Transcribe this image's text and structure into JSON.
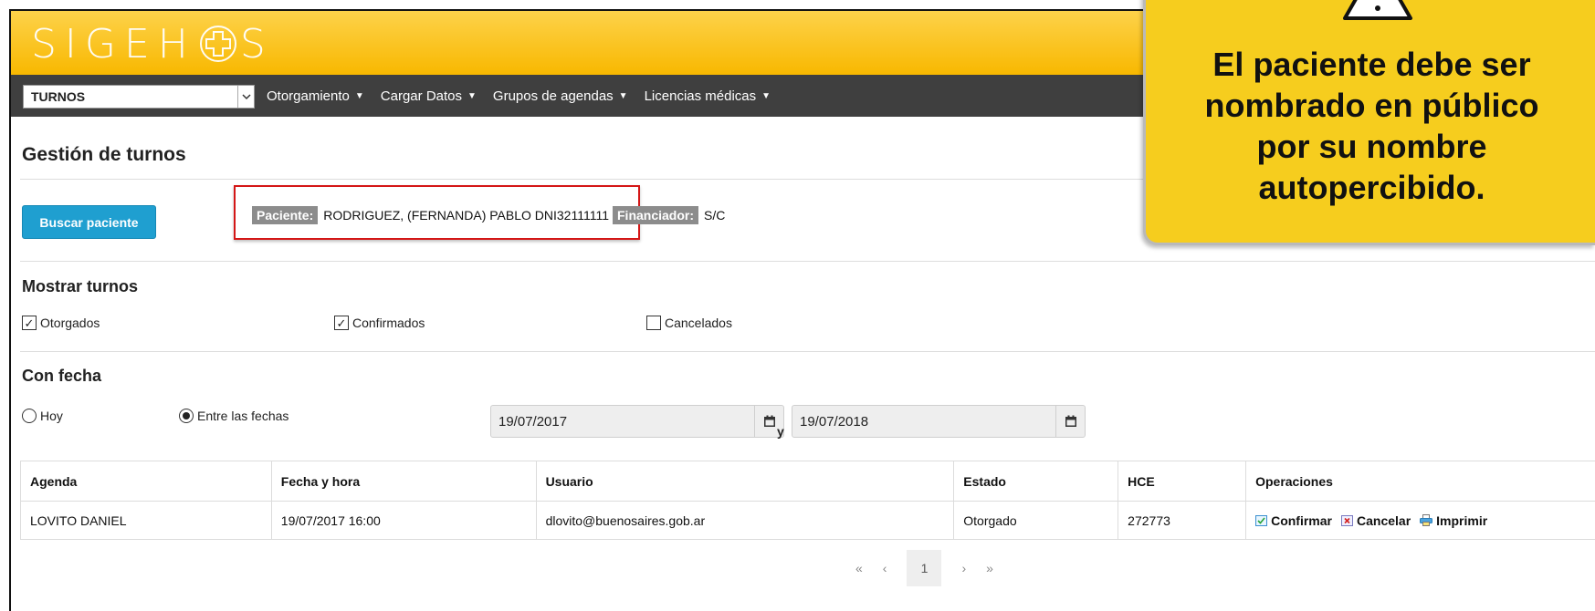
{
  "app": {
    "logo_left": "SIGEH",
    "logo_right": "S"
  },
  "nav": {
    "module": "TURNOS",
    "menu": [
      {
        "label": "Otorgamiento"
      },
      {
        "label": "Cargar Datos"
      },
      {
        "label": "Grupos de agendas"
      },
      {
        "label": "Licencias médicas"
      }
    ]
  },
  "page": {
    "title": "Gestión de turnos",
    "search_button": "Buscar paciente",
    "patient_tag": "Paciente:",
    "patient_name": "RODRIGUEZ, (FERNANDA) PABLO DNI32111111",
    "financiador_tag": "Financiador:",
    "financiador_value": "S/C"
  },
  "filters": {
    "title": "Mostrar turnos",
    "otorgados": "Otorgados",
    "confirmados": "Confirmados",
    "cancelados": "Cancelados"
  },
  "fecha": {
    "title": "Con fecha",
    "hoy": "Hoy",
    "entre": "Entre las fechas",
    "from": "19/07/2017",
    "connector": "y",
    "to": "19/07/2018"
  },
  "table": {
    "headers": [
      "Agenda",
      "Fecha y hora",
      "Usuario",
      "Estado",
      "HCE",
      "Operaciones"
    ],
    "rows": [
      [
        "LOVITO DANIEL",
        "19/07/2017 16:00",
        "dlovito@buenosaires.gob.ar",
        "Otorgado",
        "272773"
      ]
    ],
    "ops": {
      "confirm": "Confirmar",
      "cancel": "Cancelar",
      "print": "Imprimir"
    }
  },
  "pager": {
    "first": "«",
    "prev": "‹",
    "current": "1",
    "next": "›",
    "last": "»"
  },
  "callout": {
    "line1": "El paciente debe ser",
    "line2": "nombrado en público",
    "line3": "por su nombre",
    "line4": "autopercibido."
  },
  "colors": {
    "header_yellow": "#f8b800",
    "nav_dark": "#3f3f3f",
    "button_blue": "#1f9fd0",
    "highlight_red": "#d41616",
    "callout_yellow": "#f6cd1e"
  }
}
